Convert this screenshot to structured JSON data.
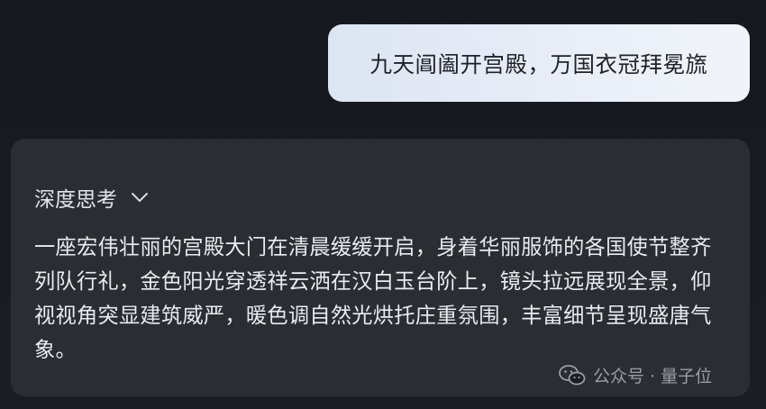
{
  "user_message": {
    "text": "九天阊阖开宫殿，万国衣冠拜冕旒"
  },
  "assistant": {
    "thinking_label": "深度思考",
    "thinking_toggle_icon": "chevron-down-icon",
    "response": "一座宏伟壮丽的宫殿大门在清晨缓缓开启，身着华丽服饰的各国使节整齐列队行礼，金色阳光穿透祥云洒在汉白玉台阶上，镜头拉远展现全景，仰视视角突显建筑威严，暖色调自然光烘托庄重氛围，丰富细节呈现盛唐气象。"
  },
  "watermark": {
    "icon": "wechat-icon",
    "text": "公众号 · 量子位"
  },
  "colors": {
    "background": "#15191f",
    "user_bubble": "#e8edf6",
    "assistant_card": "#2b2d33",
    "text_light": "#e9ebee",
    "text_dark": "#1f2229"
  }
}
